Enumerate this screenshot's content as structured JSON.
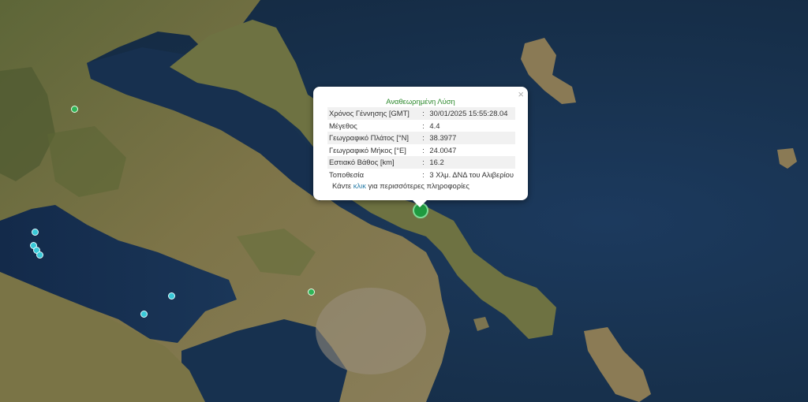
{
  "popup": {
    "title": "Αναθεωρημένη Λύση",
    "close": "×",
    "rows": [
      {
        "label": "Χρόνος Γέννησης [GMT]",
        "value": "30/01/2025 15:55:28.04"
      },
      {
        "label": "Μέγεθος",
        "value": "4.4"
      },
      {
        "label": "Γεωγραφικό Πλάτος [°N]",
        "value": "38.3977"
      },
      {
        "label": "Γεωγραφικό Μήκος [°E]",
        "value": "24.0047"
      },
      {
        "label": "Εστιακό Βάθος [km]",
        "value": "16.2"
      },
      {
        "label": "Τοποθεσία",
        "value": "3 Χλμ. ΔΝΔ του Αλιβερίου"
      }
    ],
    "separator": ":",
    "footer_prefix": "Κάντε ",
    "footer_link": "κλικ",
    "footer_suffix": " για περισσότερες πληροφορίες"
  },
  "colors": {
    "sea": "#18324f",
    "land": "#6f6a3e",
    "green_marker": "#2fb457",
    "cyan_marker": "#38c9d8",
    "title_green": "#2e8a2e",
    "link": "#2a7da8"
  }
}
